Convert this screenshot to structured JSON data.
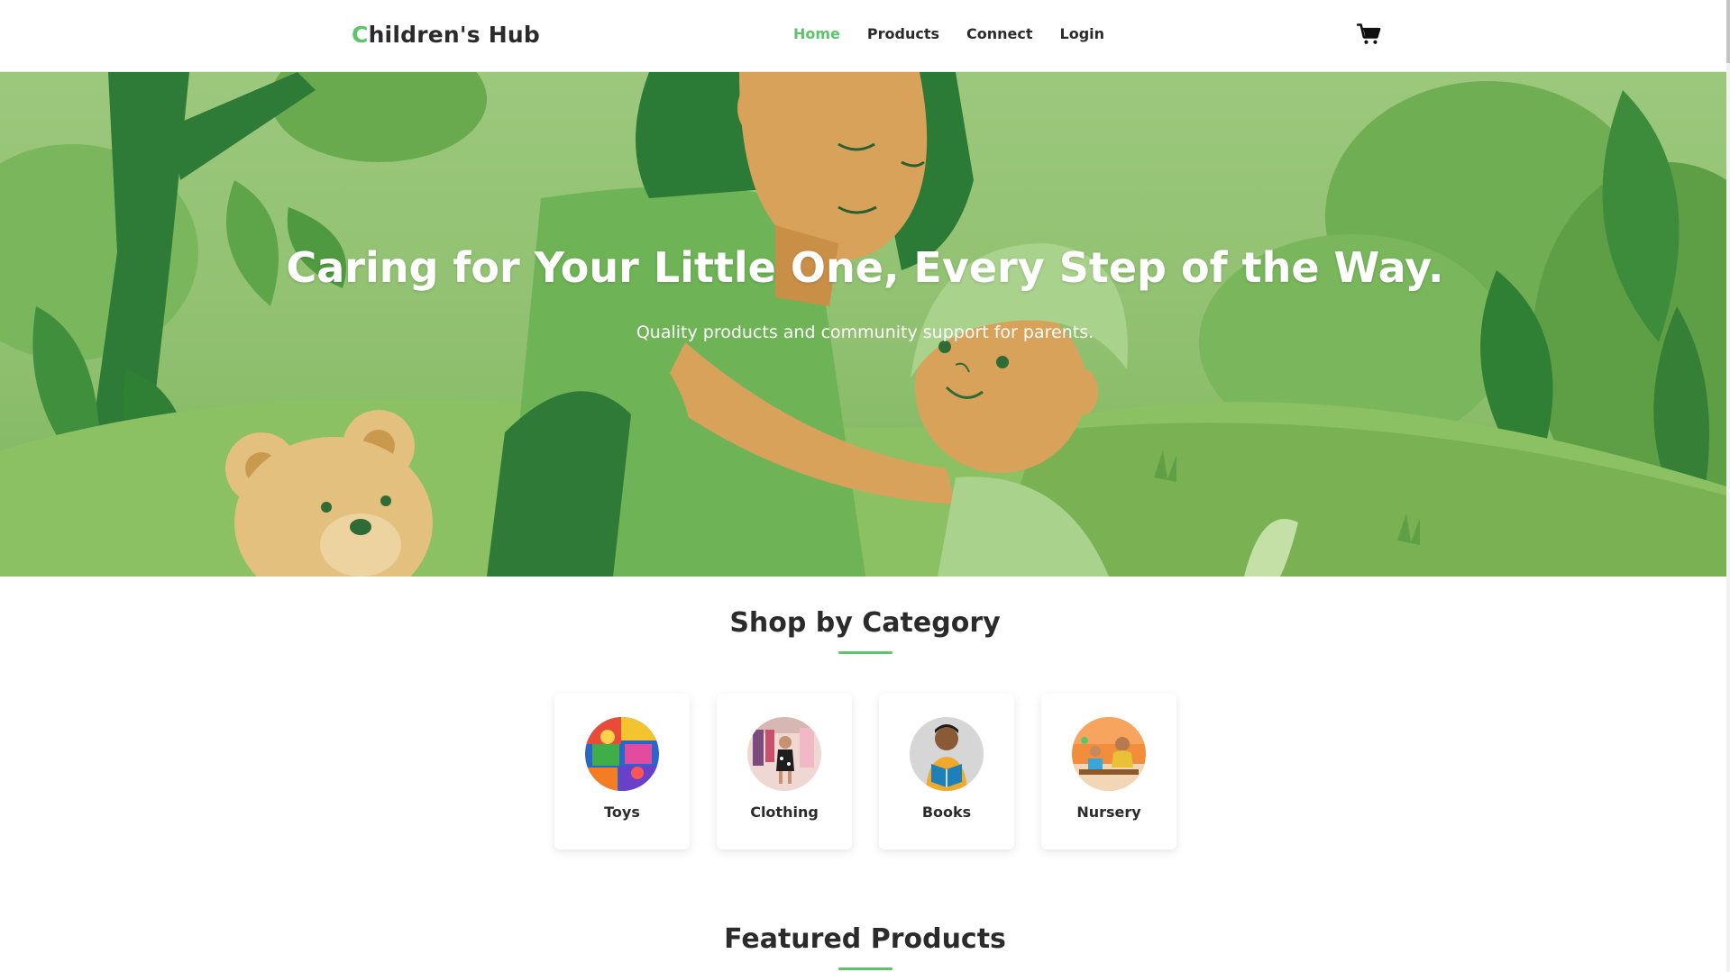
{
  "header": {
    "logo_first": "C",
    "logo_rest": "hildren's Hub",
    "nav": [
      {
        "label": "Home",
        "active": true
      },
      {
        "label": "Products",
        "active": false
      },
      {
        "label": "Connect",
        "active": false
      },
      {
        "label": "Login",
        "active": false
      }
    ],
    "cart_icon": "shopping-cart-icon"
  },
  "hero": {
    "title": "Caring for Your Little One, Every Step of the Way.",
    "subtitle": "Quality products and community support for parents."
  },
  "categories": {
    "title": "Shop by Category",
    "items": [
      {
        "label": "Toys"
      },
      {
        "label": "Clothing"
      },
      {
        "label": "Books"
      },
      {
        "label": "Nursery"
      }
    ]
  },
  "featured": {
    "title": "Featured Products"
  },
  "colors": {
    "accent": "#5cc46b",
    "text": "#2b2b2b",
    "hero_green": "#8fc06f"
  }
}
